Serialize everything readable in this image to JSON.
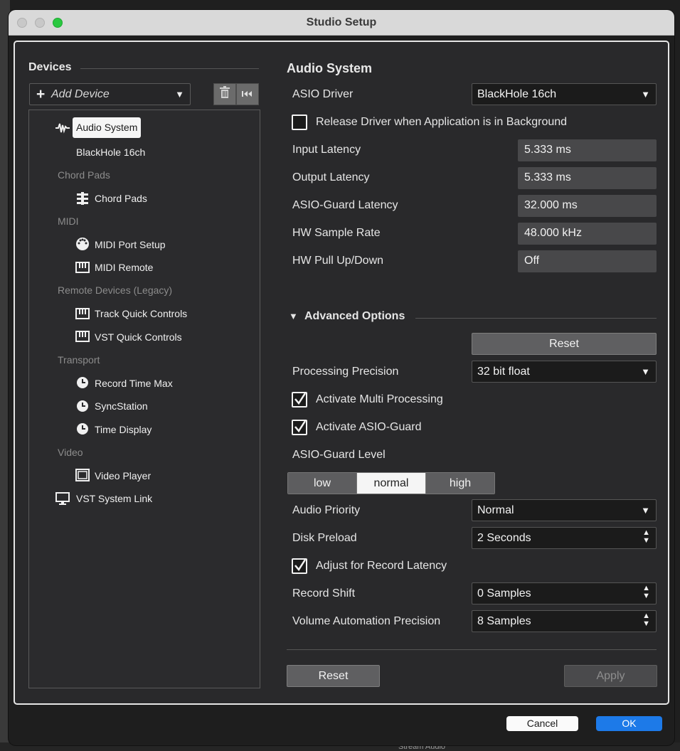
{
  "window": {
    "title": "Studio Setup"
  },
  "devices": {
    "section_label": "Devices",
    "add_device_label": "Add Device",
    "tree": {
      "audio_system": "Audio System",
      "blackhole": "BlackHole 16ch",
      "cat_chord_pads": "Chord Pads",
      "chord_pads": "Chord Pads",
      "cat_midi": "MIDI",
      "midi_port_setup": "MIDI Port Setup",
      "midi_remote": "MIDI Remote",
      "cat_remote": "Remote Devices (Legacy)",
      "track_quick_controls": "Track Quick Controls",
      "vst_quick_controls": "VST Quick Controls",
      "cat_transport": "Transport",
      "record_time_max": "Record Time Max",
      "syncstation": "SyncStation",
      "time_display": "Time Display",
      "cat_video": "Video",
      "video_player": "Video Player",
      "vst_system_link": "VST System Link"
    }
  },
  "audio_system": {
    "title": "Audio System",
    "asio_driver_label": "ASIO Driver",
    "asio_driver_value": "BlackHole 16ch",
    "release_driver_label": "Release Driver when Application is in Background",
    "release_driver_checked": false,
    "input_latency_label": "Input Latency",
    "input_latency_value": "5.333 ms",
    "output_latency_label": "Output Latency",
    "output_latency_value": "5.333 ms",
    "asio_guard_latency_label": "ASIO-Guard Latency",
    "asio_guard_latency_value": "32.000 ms",
    "hw_sample_rate_label": "HW Sample Rate",
    "hw_sample_rate_value": "48.000 kHz",
    "hw_pull_label": "HW Pull Up/Down",
    "hw_pull_value": "Off"
  },
  "advanced": {
    "title": "Advanced Options",
    "reset_label": "Reset",
    "processing_precision_label": "Processing Precision",
    "processing_precision_value": "32 bit float",
    "multi_processing_label": "Activate Multi Processing",
    "multi_processing_checked": true,
    "asio_guard_label": "Activate ASIO-Guard",
    "asio_guard_checked": true,
    "asio_guard_level_label": "ASIO-Guard Level",
    "levels": [
      "low",
      "normal",
      "high"
    ],
    "selected_level": "normal",
    "audio_priority_label": "Audio Priority",
    "audio_priority_value": "Normal",
    "disk_preload_label": "Disk Preload",
    "disk_preload_value": "2 Seconds",
    "adjust_record_latency_label": "Adjust for Record Latency",
    "adjust_record_latency_checked": true,
    "record_shift_label": "Record Shift",
    "record_shift_value": "0 Samples",
    "volume_automation_label": "Volume Automation Precision",
    "volume_automation_value": "8 Samples"
  },
  "panel_buttons": {
    "reset": "Reset",
    "apply": "Apply"
  },
  "footer": {
    "cancel": "Cancel",
    "ok": "OK"
  },
  "background": {
    "track_label": "Stream Audio"
  }
}
